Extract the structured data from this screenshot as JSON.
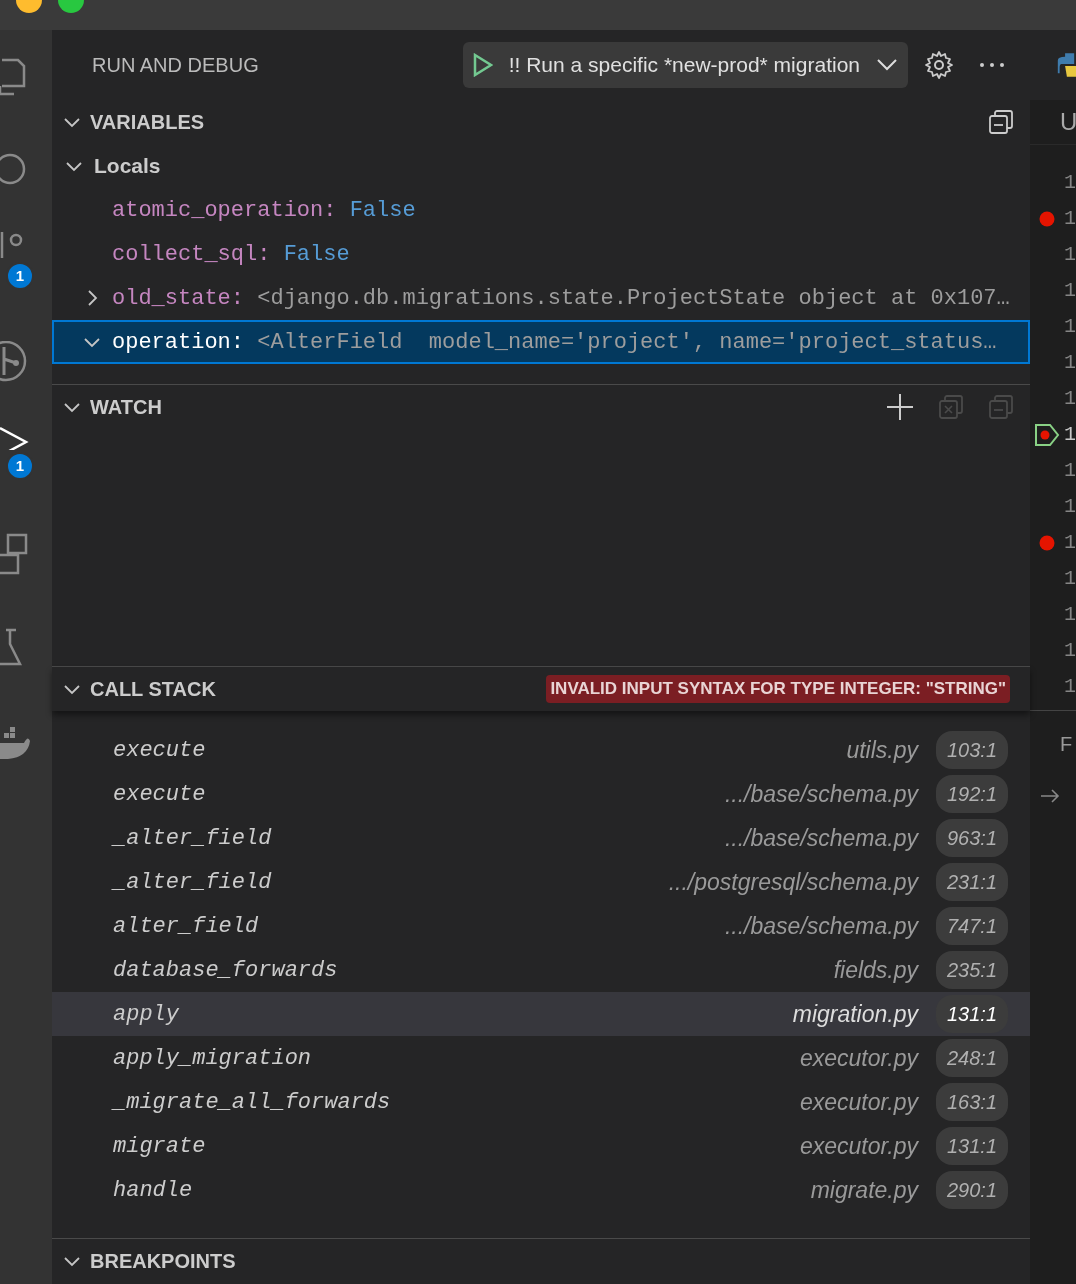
{
  "activity_bar": [
    {
      "kind": "files"
    },
    {
      "kind": "search"
    },
    {
      "kind": "source-control",
      "badge": "1"
    },
    {
      "kind": "graph"
    },
    {
      "kind": "run-debug",
      "badge": "1"
    },
    {
      "kind": "extensions"
    },
    {
      "kind": "testing"
    },
    {
      "kind": "docker"
    }
  ],
  "view_title": "RUN AND DEBUG",
  "launch_config": "!! Run a specific *new-prod* migration",
  "variables": {
    "title": "VARIABLES",
    "expanded": true,
    "items": [
      {
        "name": "Locals",
        "kind": "scope",
        "expanded": true,
        "selected": false,
        "children": [
          {
            "name": "atomic_operation:",
            "value": "False",
            "kind": "boolean",
            "selected": false
          },
          {
            "name": "collect_sql:",
            "value": "False",
            "kind": "boolean",
            "selected": false
          },
          {
            "name": "old_state:",
            "value": "<django.db.migrations.state.ProjectState object at 0x107…",
            "kind": "object",
            "expanded": false,
            "selected": false
          },
          {
            "name": "operation:",
            "value": "<AlterField  model_name='project', name='project_status…",
            "kind": "object",
            "expanded": true,
            "selected": true
          }
        ]
      }
    ]
  },
  "watch": {
    "title": "WATCH",
    "expanded": true
  },
  "call_stack": {
    "title": "CALL STACK",
    "expanded": true,
    "error": "INVALID INPUT SYNTAX FOR TYPE INTEGER: \"STRING\"",
    "frames": [
      {
        "name": "execute",
        "file": "utils.py",
        "position": "103:1",
        "selected": false
      },
      {
        "name": "execute",
        "file": ".../base/schema.py",
        "position": "192:1",
        "selected": false
      },
      {
        "name": "_alter_field",
        "file": ".../base/schema.py",
        "position": "963:1",
        "selected": false
      },
      {
        "name": "_alter_field",
        "file": ".../postgresql/schema.py",
        "position": "231:1",
        "selected": false
      },
      {
        "name": "alter_field",
        "file": ".../base/schema.py",
        "position": "747:1",
        "selected": false
      },
      {
        "name": "database_forwards",
        "file": "fields.py",
        "position": "235:1",
        "selected": false
      },
      {
        "name": "apply",
        "file": "migration.py",
        "position": "131:1",
        "selected": true
      },
      {
        "name": "apply_migration",
        "file": "executor.py",
        "position": "248:1",
        "selected": false
      },
      {
        "name": "_migrate_all_forwards",
        "file": "executor.py",
        "position": "163:1",
        "selected": false
      },
      {
        "name": "migrate",
        "file": "executor.py",
        "position": "131:1",
        "selected": false
      },
      {
        "name": "handle",
        "file": "migrate.py",
        "position": "290:1",
        "selected": false
      }
    ]
  },
  "breakpoints": {
    "title": "BREAKPOINTS",
    "expanded": true
  },
  "editor": {
    "header_fragment": "U",
    "panel_fragment": "F",
    "gutter": [
      {
        "number": "1",
        "kind": "plain"
      },
      {
        "number": "1",
        "kind": "breakpoint"
      },
      {
        "number": "1",
        "kind": "plain"
      },
      {
        "number": "1",
        "kind": "plain"
      },
      {
        "number": "1",
        "kind": "plain"
      },
      {
        "number": "1",
        "kind": "plain"
      },
      {
        "number": "1",
        "kind": "plain"
      },
      {
        "number": "1",
        "kind": "current"
      },
      {
        "number": "1",
        "kind": "plain"
      },
      {
        "number": "1",
        "kind": "plain"
      },
      {
        "number": "1",
        "kind": "breakpoint"
      },
      {
        "number": "1",
        "kind": "plain"
      },
      {
        "number": "1",
        "kind": "plain"
      },
      {
        "number": "1",
        "kind": "plain"
      },
      {
        "number": "1",
        "kind": "plain"
      }
    ]
  }
}
